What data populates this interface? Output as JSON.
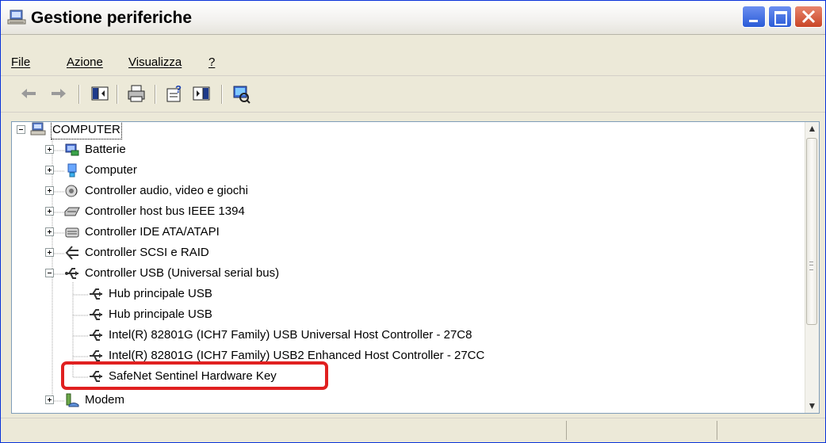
{
  "window": {
    "title": "Gestione periferiche"
  },
  "menu": [
    {
      "label": "File"
    },
    {
      "label": "Azione"
    },
    {
      "label": "Visualizza"
    },
    {
      "label": "?"
    }
  ],
  "toolbar": {
    "buttons": [
      "back-arrow-icon",
      "forward-arrow-icon",
      "show-hide-console-tree-icon",
      "print-icon",
      "properties-help-icon",
      "details-pane-icon",
      "scan-hardware-icon"
    ]
  },
  "tree": {
    "root": "COMPUTER",
    "items": [
      {
        "label": "Batterie",
        "icon": "battery-icon",
        "expanded": false
      },
      {
        "label": "Computer",
        "icon": "computer-icon",
        "expanded": false
      },
      {
        "label": "Controller audio, video e giochi",
        "icon": "speaker-icon",
        "expanded": false
      },
      {
        "label": "Controller host bus IEEE 1394",
        "icon": "ieee1394-icon",
        "expanded": false
      },
      {
        "label": "Controller IDE ATA/ATAPI",
        "icon": "ide-controller-icon",
        "expanded": false
      },
      {
        "label": "Controller SCSI e RAID",
        "icon": "scsi-controller-icon",
        "expanded": false
      },
      {
        "label": "Controller USB (Universal serial bus)",
        "icon": "usb-icon",
        "expanded": true
      },
      {
        "label": "Modem",
        "icon": "modem-icon",
        "expanded": false
      }
    ],
    "usb_children": [
      {
        "label": "Hub principale USB"
      },
      {
        "label": "Hub principale USB"
      },
      {
        "label": "Intel(R) 82801G (ICH7 Family) USB Universal Host Controller - 27C8"
      },
      {
        "label": "Intel(R) 82801G (ICH7 Family) USB2 Enhanced Host Controller - 27CC"
      },
      {
        "label": "SafeNet Sentinel Hardware Key"
      }
    ]
  },
  "colors": {
    "highlight": "#e02020",
    "title_bar_border": "#0831d9"
  }
}
